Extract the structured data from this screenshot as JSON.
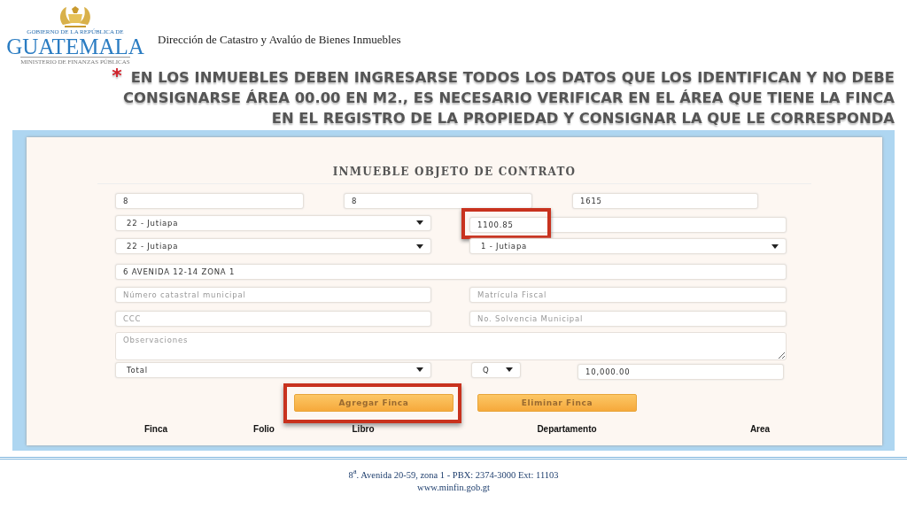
{
  "header": {
    "logo": {
      "top_line": "GOBIERNO DE LA REPÚBLICA DE",
      "name": "GUATEMALA",
      "bottom_line": "MINISTERIO DE FINANZAS PÚBLICAS"
    },
    "department": "Dirección de Catastro y Avalúo de Bienes Inmuebles"
  },
  "note": {
    "bullet": "*",
    "text": "EN LOS INMUEBLES DEBEN INGRESARSE TODOS LOS DATOS QUE LOS IDENTIFICAN Y NO DEBE CONSIGNARSE ÁREA 00.00 EN M2., ES NECESARIO VERIFICAR EN EL ÁREA QUE TIENE LA FINCA EN EL REGISTRO DE LA PROPIEDAD Y CONSIGNAR LA QUE LE CORRESPONDA"
  },
  "form": {
    "title": "INMUEBLE OBJETO DE CONTRATO",
    "rows": [
      {
        "kind": "thirds",
        "fields": [
          {
            "kind": "input",
            "value": "8",
            "highlighted": false
          },
          {
            "kind": "input",
            "value": "8",
            "highlighted": false
          },
          {
            "kind": "input",
            "value": "1615",
            "highlighted": false
          }
        ]
      },
      {
        "kind": "halves",
        "fields": [
          {
            "kind": "select",
            "value": "22 - Jutiapa",
            "highlighted": false
          },
          {
            "kind": "input",
            "value": "1100.85",
            "highlighted": true
          }
        ]
      },
      {
        "kind": "halves",
        "fields": [
          {
            "kind": "select",
            "value": "22 - Jutiapa",
            "highlighted": false
          },
          {
            "kind": "select",
            "value": "1 - Jutiapa",
            "highlighted": false
          }
        ]
      },
      {
        "kind": "full",
        "fields": [
          {
            "kind": "input",
            "value": "6 AVENIDA 12-14 ZONA 1",
            "highlighted": false
          }
        ]
      },
      {
        "kind": "halves",
        "fields": [
          {
            "kind": "input",
            "placeholder": "Número catastral municipal",
            "highlighted": false
          },
          {
            "kind": "input",
            "placeholder": "Matrícula Fiscal",
            "highlighted": false
          }
        ]
      },
      {
        "kind": "halves",
        "fields": [
          {
            "kind": "input",
            "placeholder": "CCC",
            "highlighted": false
          },
          {
            "kind": "input",
            "placeholder": "No. Solvencia Municipal",
            "highlighted": false
          }
        ]
      },
      {
        "kind": "full",
        "fields": [
          {
            "kind": "textarea",
            "placeholder": "Observaciones",
            "highlighted": false
          }
        ]
      },
      {
        "kind": "amount",
        "fields": [
          {
            "kind": "select",
            "value": "Total",
            "highlighted": false
          },
          {
            "kind": "select",
            "value": "Q",
            "highlighted": false
          },
          {
            "kind": "input",
            "value": "10,000.00",
            "highlighted": false
          }
        ]
      }
    ],
    "buttons": [
      {
        "label": "Agregar Finca",
        "highlighted": true
      },
      {
        "label": "Eliminar Finca",
        "highlighted": false
      }
    ],
    "table_columns": [
      "Finca",
      "Folio",
      "Libro",
      "Departamento",
      "Area"
    ]
  },
  "footer": {
    "address": "8$^{a}$. Avenida 20-59, zona 1 -  PBX: 2374-3000  Ext: 11103",
    "website": "www.minfin.gob.gt"
  }
}
